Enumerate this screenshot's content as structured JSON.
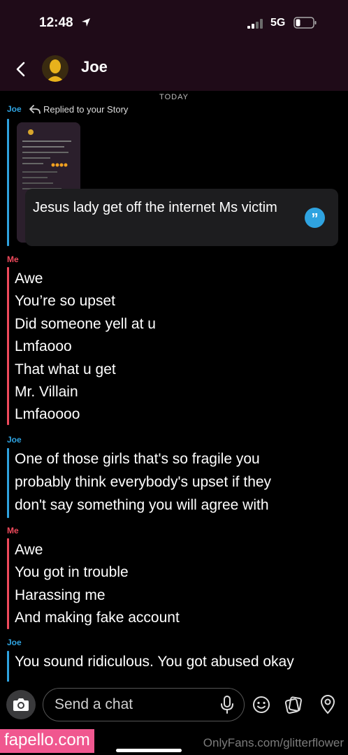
{
  "status": {
    "time": "12:48",
    "network": "5G"
  },
  "header": {
    "title": "Joe",
    "back_icon": "chevron-left-icon",
    "avatar_icon": "bitmoji-avatar"
  },
  "chat": {
    "date_separator": "TODAY",
    "story_reply": {
      "sender": "Joe",
      "note": "Replied to your Story",
      "quote": "Jesus lady get off the internet Ms victim"
    },
    "groups": [
      {
        "sender": "Me",
        "lines": [
          "Awe",
          "You’re so upset",
          "Did someone yell at u",
          "Lmfaooo",
          "That what u get",
          "Mr. Villain",
          "Lmfaoooo"
        ]
      },
      {
        "sender": "Joe",
        "lines": [
          "One of those girls that's so fragile you",
          "probably think everybody's upset if they",
          "don't say something you will agree with"
        ]
      },
      {
        "sender": "Me",
        "lines": [
          "Awe",
          "You got in trouble",
          "Harassing me",
          "And making fake account"
        ]
      },
      {
        "sender": "Joe",
        "lines": [
          "You sound ridiculous. You got abused okay"
        ]
      }
    ]
  },
  "composer": {
    "placeholder": "Send a chat"
  },
  "footer": {
    "watermark": "fapello.com",
    "of_watermark": "OnlyFans.com/glitterflower"
  },
  "colors": {
    "joe": "#2fa3e0",
    "me": "#f04a5c",
    "header_bg": "#1f0b18",
    "watermark_bg": "#f0578f"
  }
}
